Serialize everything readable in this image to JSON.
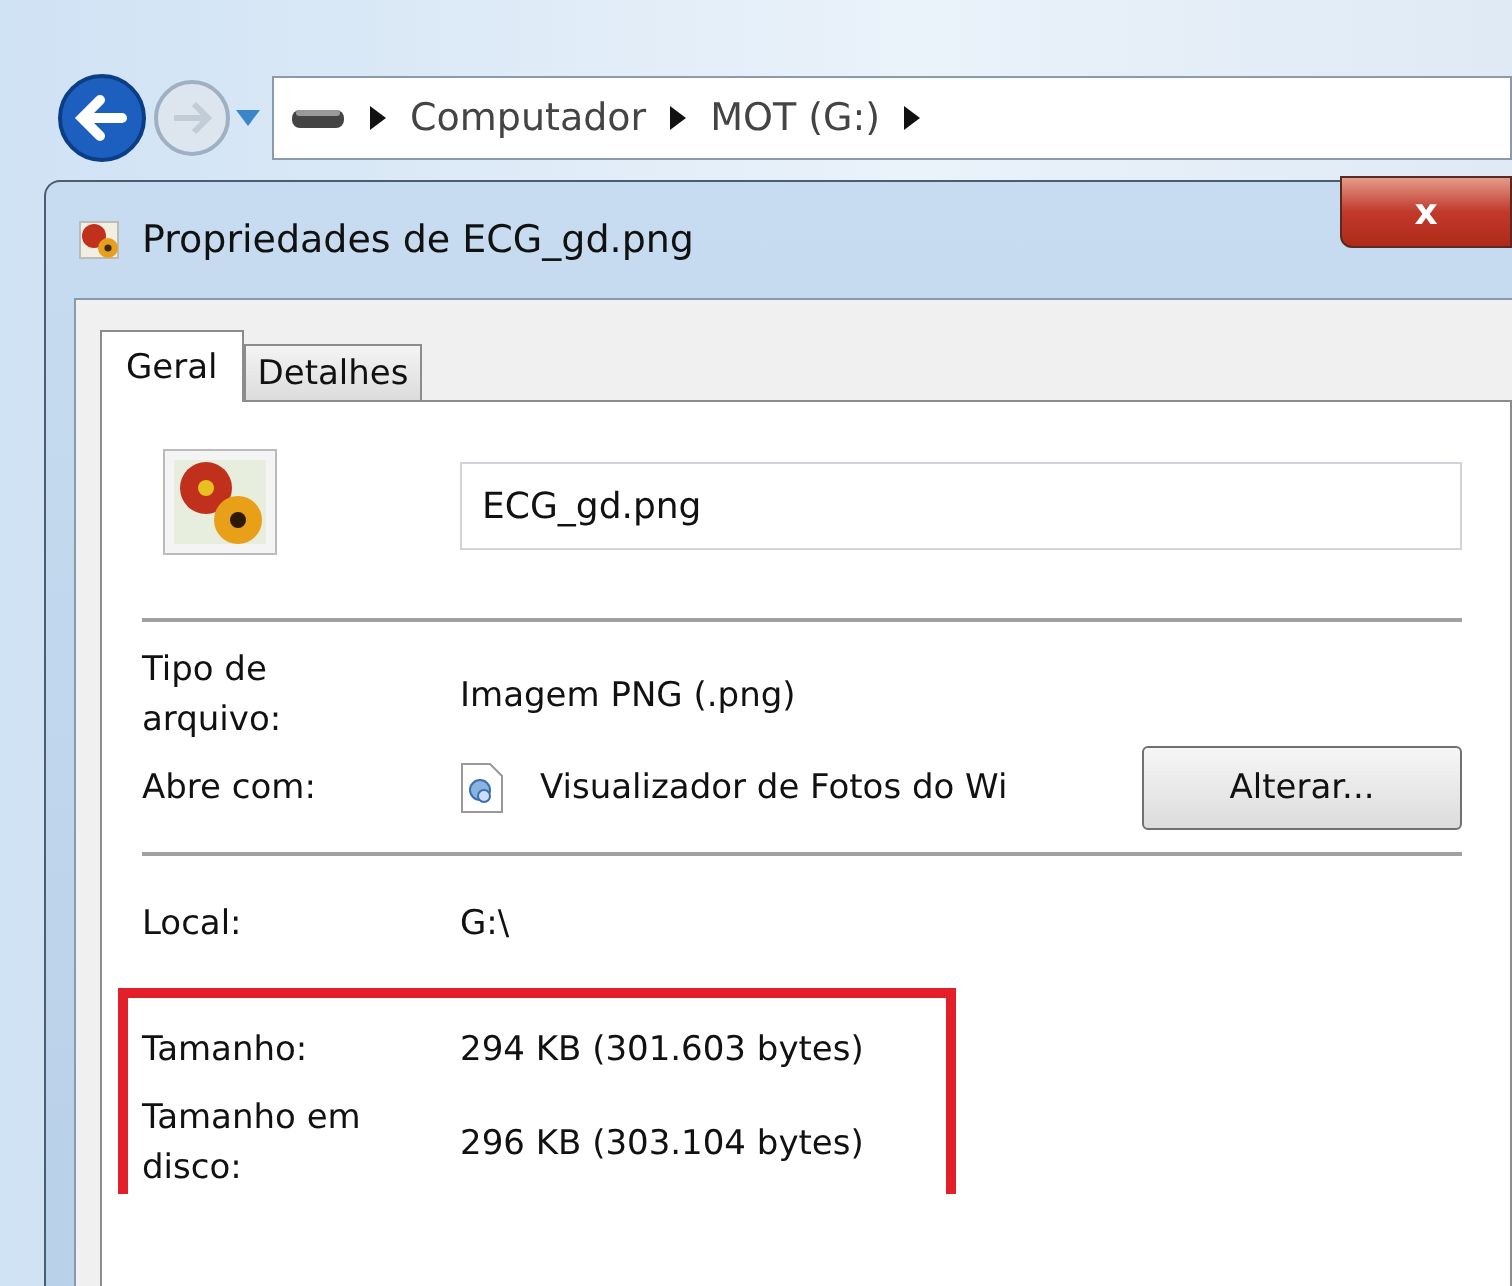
{
  "address_bar": {
    "crumbs": [
      "Computador",
      "MOT (G:)"
    ]
  },
  "window": {
    "title": "Propriedades de ECG_gd.png",
    "close": "x"
  },
  "tabs": [
    {
      "label": "Geral",
      "selected": true
    },
    {
      "label": "Detalhes",
      "selected": false
    }
  ],
  "file_name": "ECG_gd.png",
  "sections": [
    {
      "highlighted": false,
      "rows": [
        {
          "kind": "text",
          "label": "Tipo de\narquivo:",
          "value": "Imagem PNG (.png)"
        },
        {
          "kind": "app",
          "label": "Abre com:",
          "value": "Visualizador de Fotos do Wi",
          "button": "Alterar..."
        }
      ]
    },
    {
      "highlighted": false,
      "rows": [
        {
          "kind": "text",
          "label": "Local:",
          "value": "G:\\"
        }
      ]
    },
    {
      "highlighted": true,
      "rows": [
        {
          "kind": "text",
          "label": "Tamanho:",
          "value": "294 KB (301.603 bytes)"
        },
        {
          "kind": "text",
          "label": "Tamanho em\ndisco:",
          "value": "296 KB (303.104 bytes)"
        }
      ]
    }
  ]
}
